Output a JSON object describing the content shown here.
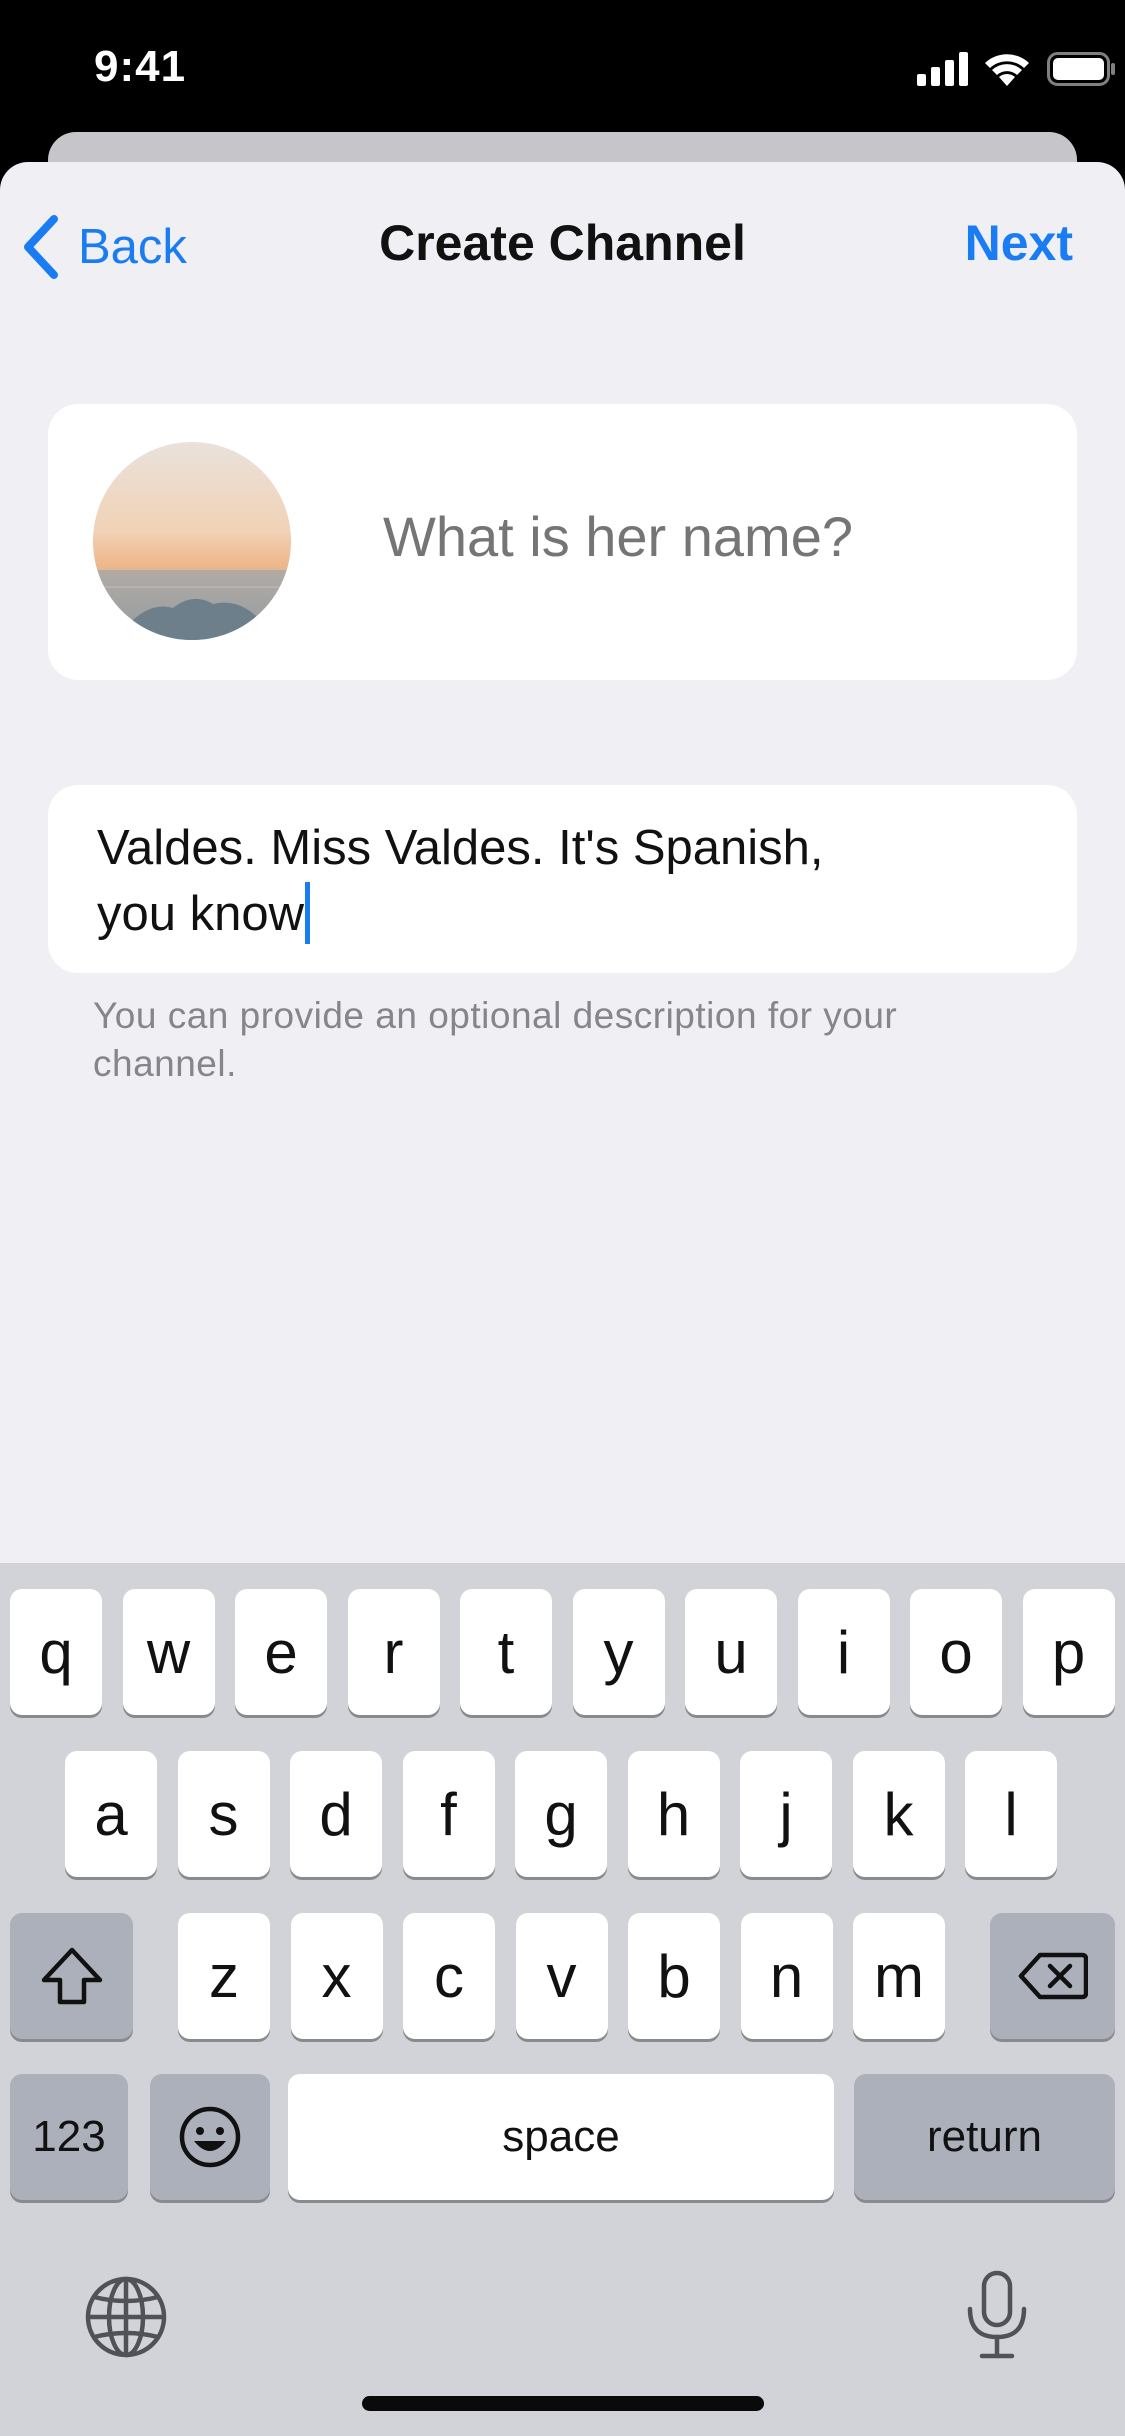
{
  "status_bar": {
    "time": "9:41"
  },
  "nav": {
    "back_label": "Back",
    "title": "Create Channel",
    "next_label": "Next"
  },
  "channel": {
    "name_placeholder": "What is her name?",
    "description_line1": "Valdes. Miss Valdes. It's Spanish,",
    "description_line2": "you know",
    "hint": "You can provide an optional description for your channel."
  },
  "keyboard": {
    "row1": [
      "q",
      "w",
      "e",
      "r",
      "t",
      "y",
      "u",
      "i",
      "o",
      "p"
    ],
    "row2": [
      "a",
      "s",
      "d",
      "f",
      "g",
      "h",
      "j",
      "k",
      "l"
    ],
    "row3": [
      "z",
      "x",
      "c",
      "v",
      "b",
      "n",
      "m"
    ],
    "numbers_label": "123",
    "space_label": "space",
    "return_label": "return"
  },
  "colors": {
    "accent": "#1a7cf2",
    "sheet_bg": "#efeff4",
    "keyboard_bg": "#d1d3d9",
    "hint": "#85858b"
  }
}
